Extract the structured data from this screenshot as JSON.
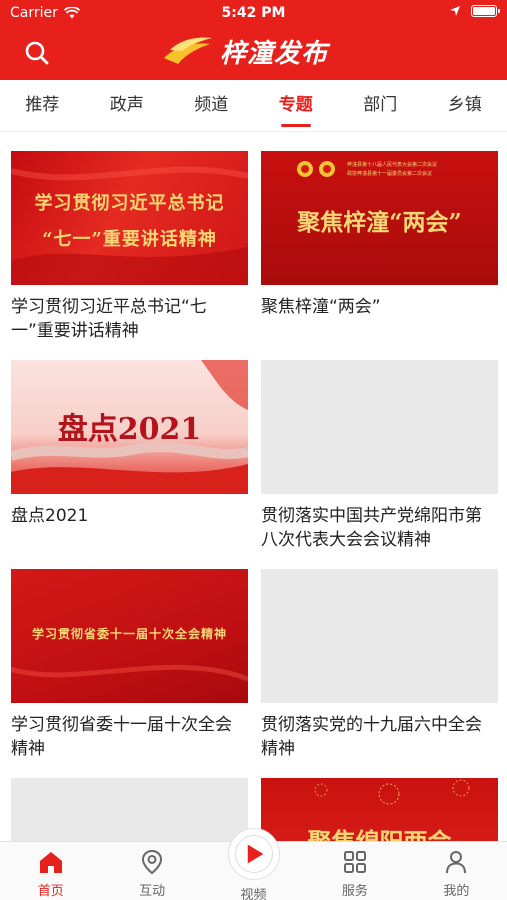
{
  "status_bar": {
    "carrier": "Carrier",
    "time": "5:42 PM",
    "battery_level": 1.0
  },
  "header": {
    "app_name": "梓潼发布"
  },
  "tabs": [
    {
      "label": "推荐",
      "active": false
    },
    {
      "label": "政声",
      "active": false
    },
    {
      "label": "频道",
      "active": false
    },
    {
      "label": "专题",
      "active": true
    },
    {
      "label": "部门",
      "active": false
    },
    {
      "label": "乡镇",
      "active": false
    }
  ],
  "cards": [
    {
      "title": "学习贯彻习近平总书记“七一”重要讲话精神",
      "banner_lines": [
        "学习贯彻习近平总书记",
        "“七一”重要讲话精神"
      ]
    },
    {
      "title": "聚焦梓潼“两会”",
      "banner_lines": [
        "聚焦梓潼“两会”"
      ],
      "banner_small": [
        "梓潼县第十八届人民代表大会第二次会议",
        "政协梓潼县第十一届委员会第二次会议"
      ]
    },
    {
      "title": "盘点2021",
      "banner_lines": [
        "盘点2021"
      ]
    },
    {
      "title": "贯彻落实中国共产党绵阳市第八次代表大会会议精神",
      "banner_lines": []
    },
    {
      "title": "学习贯彻省委十一届十次全会精神",
      "banner_lines": [
        "学习贯彻省委十一届十次全会精神"
      ]
    },
    {
      "title": "贯彻落实党的十九届六中全会精神",
      "banner_lines": []
    },
    {
      "title": "",
      "banner_lines": []
    },
    {
      "title": "",
      "banner_lines": [
        "聚焦绵阳两会"
      ]
    }
  ],
  "tabbar": [
    {
      "label": "首页",
      "icon": "home-icon",
      "active": true
    },
    {
      "label": "互动",
      "icon": "location-pin-icon",
      "active": false
    },
    {
      "label": "视频",
      "icon": "play-icon",
      "active": false
    },
    {
      "label": "服务",
      "icon": "grid-icon",
      "active": false
    },
    {
      "label": "我的",
      "icon": "user-icon",
      "active": false
    }
  ],
  "colors": {
    "brand_red": "#e8201c",
    "banner_gold": "#f7d774",
    "placeholder_gray": "#e9e9e9"
  }
}
